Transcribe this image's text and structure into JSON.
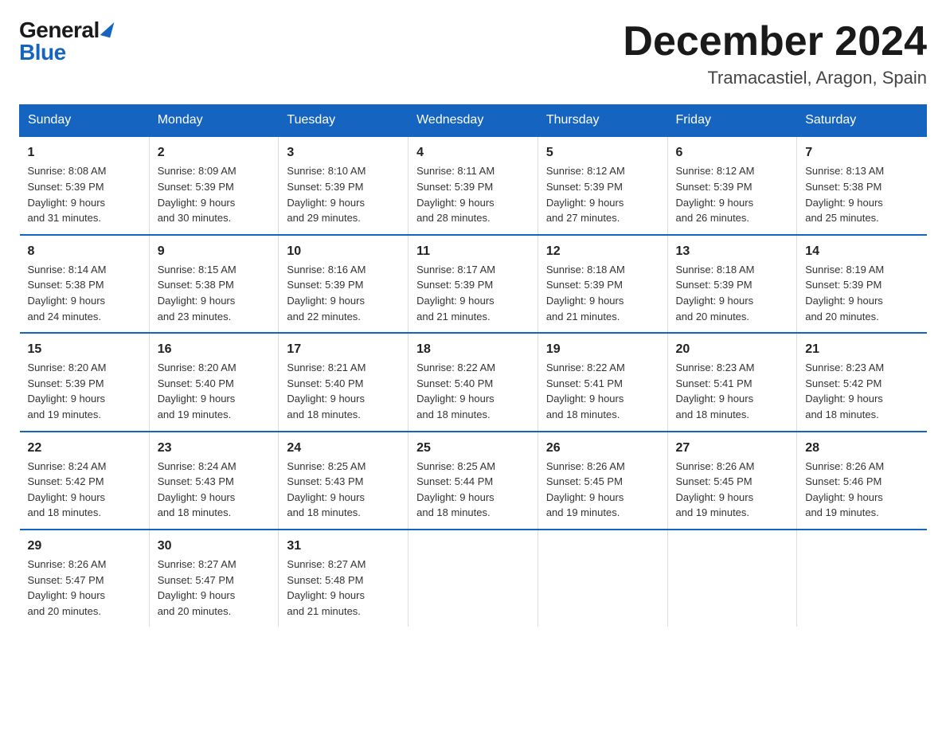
{
  "logo": {
    "general": "General",
    "blue": "Blue"
  },
  "title": "December 2024",
  "location": "Tramacastiel, Aragon, Spain",
  "days_of_week": [
    "Sunday",
    "Monday",
    "Tuesday",
    "Wednesday",
    "Thursday",
    "Friday",
    "Saturday"
  ],
  "weeks": [
    [
      {
        "day": "1",
        "sunrise": "8:08 AM",
        "sunset": "5:39 PM",
        "daylight": "9 hours and 31 minutes."
      },
      {
        "day": "2",
        "sunrise": "8:09 AM",
        "sunset": "5:39 PM",
        "daylight": "9 hours and 30 minutes."
      },
      {
        "day": "3",
        "sunrise": "8:10 AM",
        "sunset": "5:39 PM",
        "daylight": "9 hours and 29 minutes."
      },
      {
        "day": "4",
        "sunrise": "8:11 AM",
        "sunset": "5:39 PM",
        "daylight": "9 hours and 28 minutes."
      },
      {
        "day": "5",
        "sunrise": "8:12 AM",
        "sunset": "5:39 PM",
        "daylight": "9 hours and 27 minutes."
      },
      {
        "day": "6",
        "sunrise": "8:12 AM",
        "sunset": "5:39 PM",
        "daylight": "9 hours and 26 minutes."
      },
      {
        "day": "7",
        "sunrise": "8:13 AM",
        "sunset": "5:38 PM",
        "daylight": "9 hours and 25 minutes."
      }
    ],
    [
      {
        "day": "8",
        "sunrise": "8:14 AM",
        "sunset": "5:38 PM",
        "daylight": "9 hours and 24 minutes."
      },
      {
        "day": "9",
        "sunrise": "8:15 AM",
        "sunset": "5:38 PM",
        "daylight": "9 hours and 23 minutes."
      },
      {
        "day": "10",
        "sunrise": "8:16 AM",
        "sunset": "5:39 PM",
        "daylight": "9 hours and 22 minutes."
      },
      {
        "day": "11",
        "sunrise": "8:17 AM",
        "sunset": "5:39 PM",
        "daylight": "9 hours and 21 minutes."
      },
      {
        "day": "12",
        "sunrise": "8:18 AM",
        "sunset": "5:39 PM",
        "daylight": "9 hours and 21 minutes."
      },
      {
        "day": "13",
        "sunrise": "8:18 AM",
        "sunset": "5:39 PM",
        "daylight": "9 hours and 20 minutes."
      },
      {
        "day": "14",
        "sunrise": "8:19 AM",
        "sunset": "5:39 PM",
        "daylight": "9 hours and 20 minutes."
      }
    ],
    [
      {
        "day": "15",
        "sunrise": "8:20 AM",
        "sunset": "5:39 PM",
        "daylight": "9 hours and 19 minutes."
      },
      {
        "day": "16",
        "sunrise": "8:20 AM",
        "sunset": "5:40 PM",
        "daylight": "9 hours and 19 minutes."
      },
      {
        "day": "17",
        "sunrise": "8:21 AM",
        "sunset": "5:40 PM",
        "daylight": "9 hours and 18 minutes."
      },
      {
        "day": "18",
        "sunrise": "8:22 AM",
        "sunset": "5:40 PM",
        "daylight": "9 hours and 18 minutes."
      },
      {
        "day": "19",
        "sunrise": "8:22 AM",
        "sunset": "5:41 PM",
        "daylight": "9 hours and 18 minutes."
      },
      {
        "day": "20",
        "sunrise": "8:23 AM",
        "sunset": "5:41 PM",
        "daylight": "9 hours and 18 minutes."
      },
      {
        "day": "21",
        "sunrise": "8:23 AM",
        "sunset": "5:42 PM",
        "daylight": "9 hours and 18 minutes."
      }
    ],
    [
      {
        "day": "22",
        "sunrise": "8:24 AM",
        "sunset": "5:42 PM",
        "daylight": "9 hours and 18 minutes."
      },
      {
        "day": "23",
        "sunrise": "8:24 AM",
        "sunset": "5:43 PM",
        "daylight": "9 hours and 18 minutes."
      },
      {
        "day": "24",
        "sunrise": "8:25 AM",
        "sunset": "5:43 PM",
        "daylight": "9 hours and 18 minutes."
      },
      {
        "day": "25",
        "sunrise": "8:25 AM",
        "sunset": "5:44 PM",
        "daylight": "9 hours and 18 minutes."
      },
      {
        "day": "26",
        "sunrise": "8:26 AM",
        "sunset": "5:45 PM",
        "daylight": "9 hours and 19 minutes."
      },
      {
        "day": "27",
        "sunrise": "8:26 AM",
        "sunset": "5:45 PM",
        "daylight": "9 hours and 19 minutes."
      },
      {
        "day": "28",
        "sunrise": "8:26 AM",
        "sunset": "5:46 PM",
        "daylight": "9 hours and 19 minutes."
      }
    ],
    [
      {
        "day": "29",
        "sunrise": "8:26 AM",
        "sunset": "5:47 PM",
        "daylight": "9 hours and 20 minutes."
      },
      {
        "day": "30",
        "sunrise": "8:27 AM",
        "sunset": "5:47 PM",
        "daylight": "9 hours and 20 minutes."
      },
      {
        "day": "31",
        "sunrise": "8:27 AM",
        "sunset": "5:48 PM",
        "daylight": "9 hours and 21 minutes."
      },
      null,
      null,
      null,
      null
    ]
  ],
  "labels": {
    "sunrise": "Sunrise:",
    "sunset": "Sunset:",
    "daylight": "Daylight:"
  }
}
